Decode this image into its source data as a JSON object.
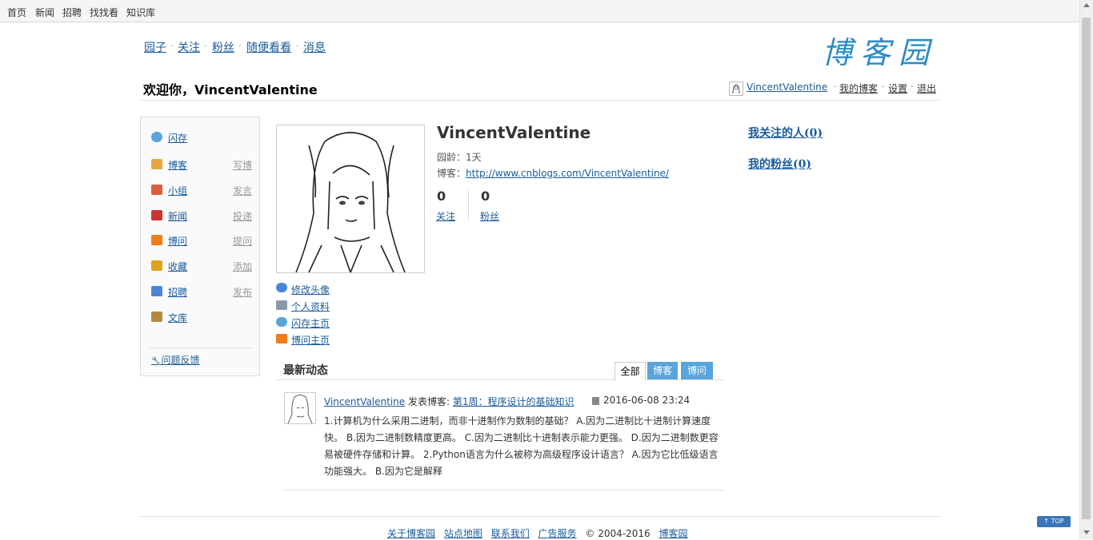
{
  "topbar": [
    "首页",
    "新闻",
    "招聘",
    "找找看",
    "知识库"
  ],
  "mainnav": [
    "园子",
    "关注",
    "粉丝",
    "随便看看",
    "消息"
  ],
  "logo": "博客园",
  "welcome": "欢迎你，VincentValentine",
  "userlinks": {
    "name": "VincentValentine",
    "myblog": "我的博客",
    "settings": "设置",
    "logout": "退出"
  },
  "sidebar": {
    "items": [
      {
        "label": "闪存",
        "action": "",
        "icon": "speech-bubble-icon",
        "color": "#5aa4dc"
      },
      {
        "label": "博客",
        "action": "写博",
        "icon": "pencil-note-icon",
        "color": "#e8a640"
      },
      {
        "label": "小组",
        "action": "发言",
        "icon": "group-people-icon",
        "color": "#d9603b"
      },
      {
        "label": "新闻",
        "action": "投递",
        "icon": "news-icon",
        "color": "#cc3333"
      },
      {
        "label": "博问",
        "action": "提问",
        "icon": "question-icon",
        "color": "#f07c1a"
      },
      {
        "label": "收藏",
        "action": "添加",
        "icon": "favorite-icon",
        "color": "#e0a020"
      },
      {
        "label": "招聘",
        "action": "发布",
        "icon": "person-card-icon",
        "color": "#4a86d8"
      },
      {
        "label": "文库",
        "action": "",
        "icon": "book-icon",
        "color": "#b48a40"
      }
    ],
    "feedback": "问题反馈"
  },
  "profile": {
    "name": "VincentValentine",
    "age_label": "园龄：",
    "age": "1天",
    "blog_label": "博客：",
    "blog_url": "http://www.cnblogs.com/VincentValentine/",
    "follow_count": "0",
    "follow_label": "关注",
    "fans_count": "0",
    "fans_label": "粉丝"
  },
  "profile_links": [
    {
      "label": "修改头像",
      "icon": "gear-icon",
      "color": "#4a86d8"
    },
    {
      "label": "个人资料",
      "icon": "id-card-icon",
      "color": "#8899aa"
    },
    {
      "label": "闪存主页",
      "icon": "speech-bubble-icon",
      "color": "#5aa4dc"
    },
    {
      "label": "博问主页",
      "icon": "question-icon",
      "color": "#f07c1a"
    }
  ],
  "right": {
    "following": "我关注的人(0)",
    "fans": "我的粉丝(0)"
  },
  "feed": {
    "title": "最新动态",
    "tabs": [
      "全部",
      "博客",
      "博问"
    ],
    "item": {
      "user": "VincentValentine",
      "verb": "发表博客:",
      "post": "第1周：程序设计的基础知识",
      "time": "2016-06-08 23:24",
      "body": "1.计算机为什么采用二进制，而非十进制作为数制的基础？ A.因为二进制比十进制计算速度快。 B.因为二进制数精度更高。 C.因为二进制比十进制表示能力更强。 D.因为二进制数更容易被硬件存储和计算。 2.Python语言为什么被称为高级程序设计语言？ A.因为它比低级语言功能强大。 B.因为它是解释"
    }
  },
  "footer": {
    "links": [
      "关于博客园",
      "站点地图",
      "联系我们",
      "广告服务"
    ],
    "copyright": "© 2004-2016",
    "site": "博客园"
  },
  "top_button": "↑ TOP"
}
